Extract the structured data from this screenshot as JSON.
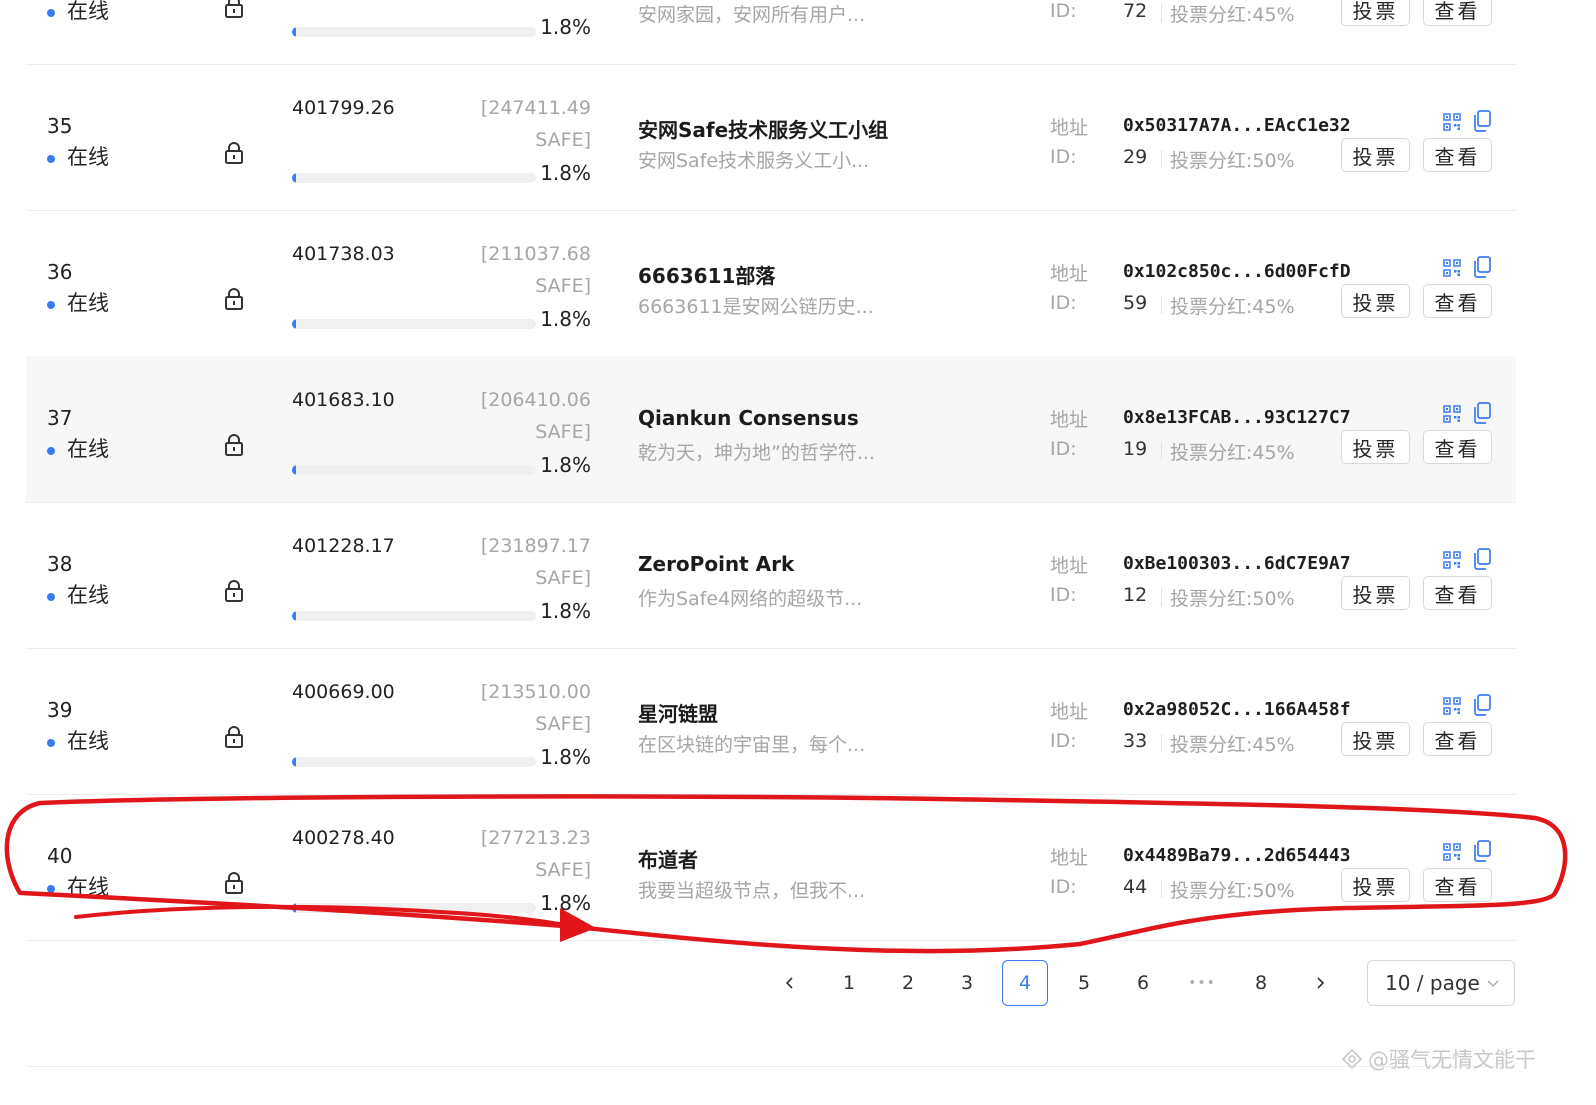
{
  "rows": [
    {
      "rank": "",
      "status": "在线",
      "amount": "",
      "bracket": "",
      "unit": "",
      "progress": 1.8,
      "pct": "1.8%",
      "name": "",
      "desc": "安网家园，安网所有用户...",
      "addr_label": "",
      "addr": "",
      "id_label": "ID:",
      "id": "72",
      "share": "投票分红:45%",
      "vote": "投票",
      "view": "查看",
      "highlight": false
    },
    {
      "rank": "35",
      "status": "在线",
      "amount": "401799.26",
      "bracket": "[247411.49",
      "unit": "SAFE]",
      "progress": 1.8,
      "pct": "1.8%",
      "name": "安网Safe技术服务义工小组",
      "desc": "安网Safe技术服务义工小...",
      "addr_label": "地址",
      "addr": "0x50317A7A...EAcC1e32",
      "id_label": "ID:",
      "id": "29",
      "share": "投票分红:50%",
      "vote": "投票",
      "view": "查看",
      "highlight": false
    },
    {
      "rank": "36",
      "status": "在线",
      "amount": "401738.03",
      "bracket": "[211037.68",
      "unit": "SAFE]",
      "progress": 1.8,
      "pct": "1.8%",
      "name": "6663611部落",
      "desc": "6663611是安网公链历史...",
      "addr_label": "地址",
      "addr": "0x102c850c...6d00FcfD",
      "id_label": "ID:",
      "id": "59",
      "share": "投票分红:45%",
      "vote": "投票",
      "view": "查看",
      "highlight": false
    },
    {
      "rank": "37",
      "status": "在线",
      "amount": "401683.10",
      "bracket": "[206410.06",
      "unit": "SAFE]",
      "progress": 1.8,
      "pct": "1.8%",
      "name": "Qiankun Consensus",
      "desc": "乾为天，坤为地”的哲学符...",
      "addr_label": "地址",
      "addr": "0x8e13FCAB...93C127C7",
      "id_label": "ID:",
      "id": "19",
      "share": "投票分红:45%",
      "vote": "投票",
      "view": "查看",
      "highlight": true
    },
    {
      "rank": "38",
      "status": "在线",
      "amount": "401228.17",
      "bracket": "[231897.17",
      "unit": "SAFE]",
      "progress": 1.8,
      "pct": "1.8%",
      "name": "ZeroPoint Ark",
      "desc": "作为Safe4网络的超级节...",
      "addr_label": "地址",
      "addr": "0xBe100303...6dC7E9A7",
      "id_label": "ID:",
      "id": "12",
      "share": "投票分红:50%",
      "vote": "投票",
      "view": "查看",
      "highlight": false
    },
    {
      "rank": "39",
      "status": "在线",
      "amount": "400669.00",
      "bracket": "[213510.00",
      "unit": "SAFE]",
      "progress": 1.8,
      "pct": "1.8%",
      "name": "星河链盟",
      "desc": "在区块链的宇宙里，每个...",
      "addr_label": "地址",
      "addr": "0x2a98052C...166A458f",
      "id_label": "ID:",
      "id": "33",
      "share": "投票分红:45%",
      "vote": "投票",
      "view": "查看",
      "highlight": false
    },
    {
      "rank": "40",
      "status": "在线",
      "amount": "400278.40",
      "bracket": "[277213.23",
      "unit": "SAFE]",
      "progress": 1.8,
      "pct": "1.8%",
      "name": "布道者",
      "desc": "我要当超级节点，但我不...",
      "addr_label": "地址",
      "addr": "0x4489Ba79...2d654443",
      "id_label": "ID:",
      "id": "44",
      "share": "投票分红:50%",
      "vote": "投票",
      "view": "查看",
      "highlight": false
    }
  ],
  "pagination": {
    "pages": [
      "1",
      "2",
      "3",
      "4",
      "5",
      "6",
      "•••",
      "8"
    ],
    "current": "4",
    "page_size": "10 / page"
  },
  "watermark": "@骚气无情文能干",
  "colors": {
    "accent": "#3b7bf0",
    "annotation": "#e0161b"
  }
}
